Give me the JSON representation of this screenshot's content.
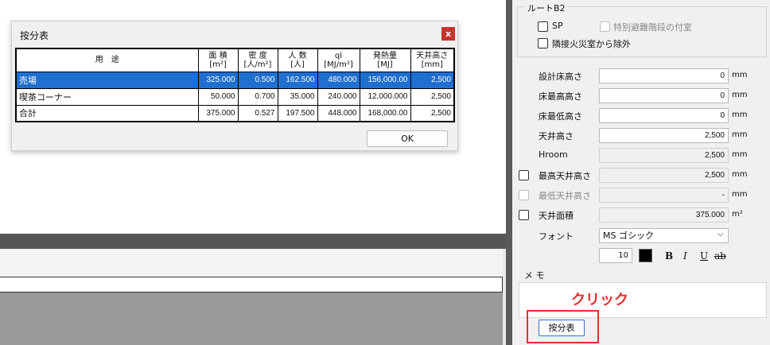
{
  "dialog": {
    "title": "按分表",
    "close": "x",
    "columns": [
      "用　途",
      "面 積\n[m²]",
      "密 度\n[人/m²]",
      "人 数\n[人]",
      "ql\n[MJ/m²]",
      "発熱量\n[MJ]",
      "天井高さ\n[mm]"
    ],
    "rows": [
      {
        "name": "売場",
        "area": "325.000",
        "density": "0.500",
        "people": "162.500",
        "ql": "480.000",
        "heat": "156,000.00",
        "ceiling": "2,500",
        "selected": true
      },
      {
        "name": "喫茶コーナー",
        "area": "50.000",
        "density": "0.700",
        "people": "35.000",
        "ql": "240.000",
        "heat": "12,000.000",
        "ceiling": "2,500",
        "selected": false
      },
      {
        "name": "合計",
        "area": "375.000",
        "density": "0.527",
        "people": "197.500",
        "ql": "448.000",
        "heat": "168,000.00",
        "ceiling": "2,500",
        "selected": false
      }
    ],
    "ok_label": "OK"
  },
  "panel": {
    "group_title": "ルートB2",
    "sp_label": "SP",
    "stair_label": "特別避難階段の付室",
    "exclude_label": "隣接火災室から除外",
    "fields": [
      {
        "label": "設計床高さ",
        "value": "0",
        "unit": "mm",
        "checkbox": "none",
        "readonly": false
      },
      {
        "label": "床最高高さ",
        "value": "0",
        "unit": "mm",
        "checkbox": "none",
        "readonly": false
      },
      {
        "label": "床最低高さ",
        "value": "0",
        "unit": "mm",
        "checkbox": "none",
        "readonly": false
      },
      {
        "label": "天井高さ",
        "value": "2,500",
        "unit": "mm",
        "checkbox": "none",
        "readonly": false
      },
      {
        "label": "Hroom",
        "value": "2,500",
        "unit": "mm",
        "checkbox": "none",
        "readonly": true
      },
      {
        "label": "最高天井高さ",
        "value": "2,500",
        "unit": "mm",
        "checkbox": "enabled",
        "readonly": true
      },
      {
        "label": "最低天井高さ",
        "value": "-",
        "unit": "mm",
        "checkbox": "disabled",
        "readonly": true
      },
      {
        "label": "天井面積",
        "value": "375.000",
        "unit": "m²",
        "checkbox": "enabled",
        "readonly": true
      }
    ],
    "font_label": "フォント",
    "font_value": "MS ゴシック",
    "font_size": "10",
    "bold": "B",
    "italic": "I",
    "underline": "U",
    "strike": "ab",
    "memo_label": "メ モ",
    "apportion_button": "按分表"
  },
  "annotation": {
    "click_label": "クリック",
    "color": "#e53030"
  },
  "colors": {
    "selection": "#1f6fd0",
    "close_button": "#c8342b"
  }
}
